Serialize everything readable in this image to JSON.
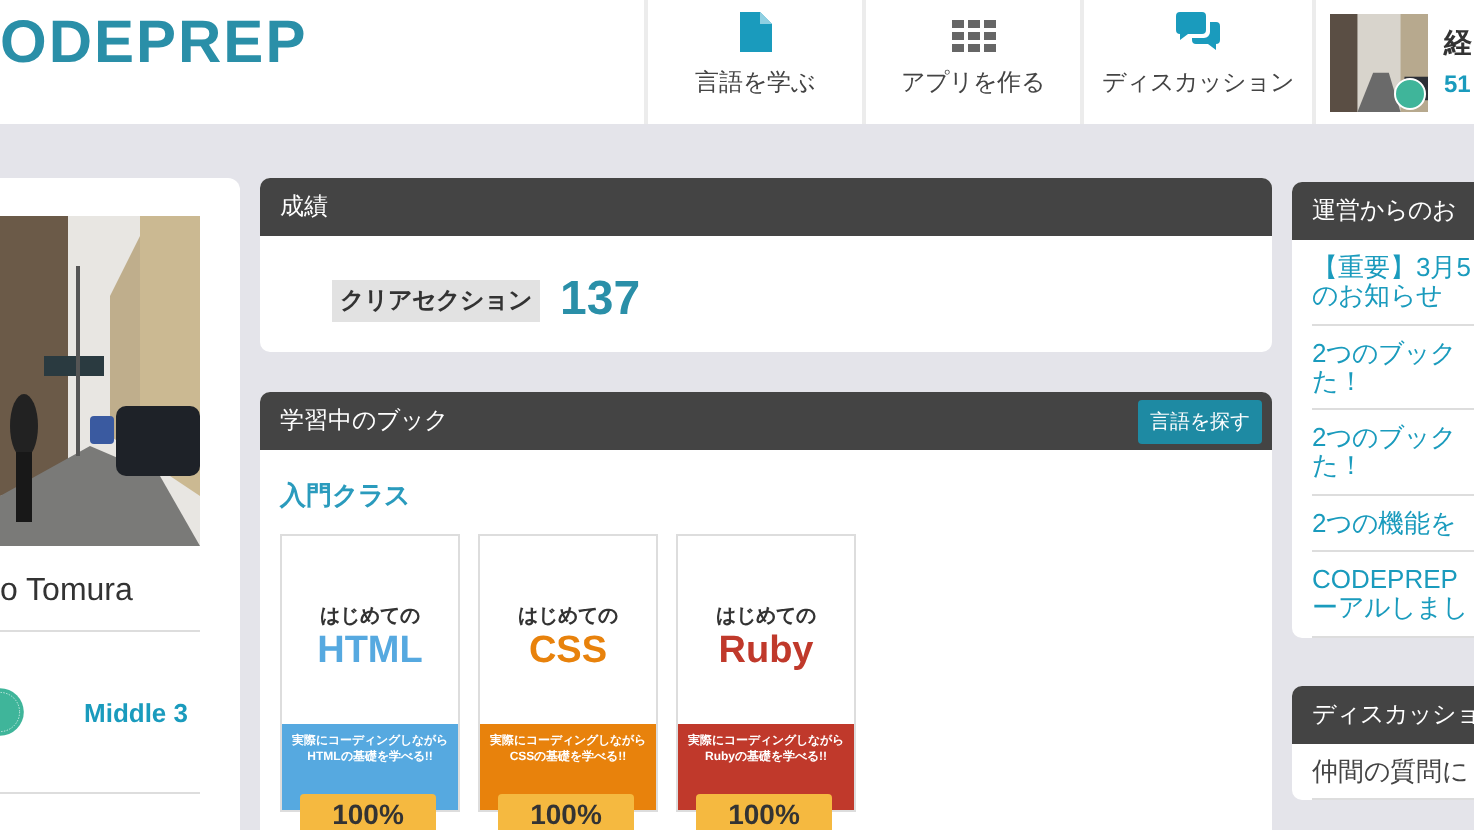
{
  "header": {
    "logo": "ODEPREP",
    "nav": [
      {
        "label": "言語を学ぶ",
        "kind": "document"
      },
      {
        "label": "アプリを作る",
        "kind": "grid"
      },
      {
        "label": "ディスカッション",
        "kind": "chat"
      }
    ],
    "user": {
      "name": "経",
      "level": "51"
    }
  },
  "profile": {
    "name": "o Tomura",
    "rank": "Middle 3"
  },
  "score": {
    "title": "成績",
    "label": "クリアセクション",
    "value": "137"
  },
  "books_panel": {
    "title": "学習中のブック",
    "button": "言語を探す",
    "class_title": "入門クラス",
    "books": [
      {
        "pre": "はじめての",
        "name": "HTML",
        "blurb": "実際にコーディングしながら\nHTMLの基礎を学べる!!",
        "progress": "100%",
        "color": "#56a9e0"
      },
      {
        "pre": "はじめての",
        "name": "CSS",
        "blurb": "実際にコーディングしながら\nCSSの基礎を学べる!!",
        "progress": "100%",
        "color": "#e8820c"
      },
      {
        "pre": "はじめての",
        "name": "Ruby",
        "blurb": "実際にコーディングしながら\nRubyの基礎を学べる!!",
        "progress": "100%",
        "color": "#c0392b"
      }
    ]
  },
  "notices": {
    "title": "運営からのお",
    "items": [
      {
        "lines": [
          "【重要】3月5",
          "のお知らせ"
        ]
      },
      {
        "lines": [
          "2つのブック",
          "た！"
        ]
      },
      {
        "lines": [
          "2つのブック",
          "た！"
        ]
      },
      {
        "lines": [
          "2つの機能を"
        ]
      },
      {
        "lines": [
          "CODEPREP",
          "ーアルしまし"
        ]
      }
    ]
  },
  "discussion": {
    "title": "ディスカッショ",
    "items": [
      "仲間の質問に"
    ]
  }
}
